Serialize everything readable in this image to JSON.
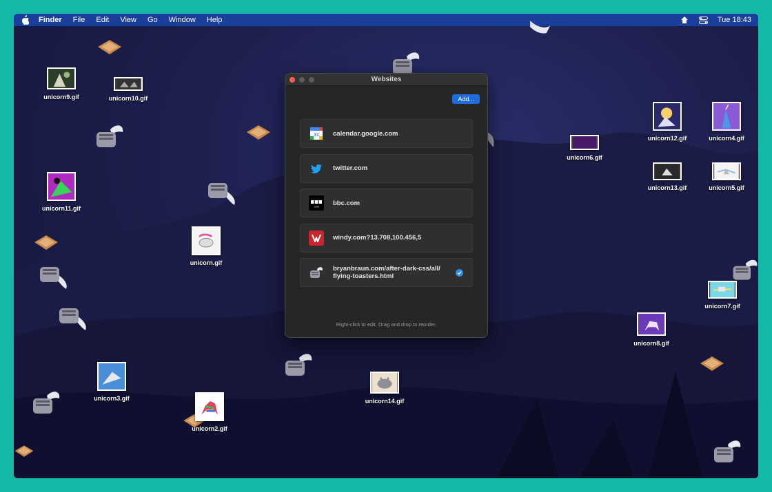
{
  "menubar": {
    "app": "Finder",
    "items": [
      "File",
      "Edit",
      "View",
      "Go",
      "Window",
      "Help"
    ],
    "clock": "Tue 18:43"
  },
  "desktop": {
    "icons": [
      {
        "name": "unicorn9.gif"
      },
      {
        "name": "unicorn10.gif"
      },
      {
        "name": "unicorn11.gif"
      },
      {
        "name": "unicorn.gif"
      },
      {
        "name": "unicorn3.gif"
      },
      {
        "name": "unicorn2.gif"
      },
      {
        "name": "unicorn14.gif"
      },
      {
        "name": "unicorn6.gif"
      },
      {
        "name": "unicorn12.gif"
      },
      {
        "name": "unicorn4.gif"
      },
      {
        "name": "unicorn13.gif"
      },
      {
        "name": "unicorn5.gif"
      },
      {
        "name": "unicorn7.gif"
      },
      {
        "name": "unicorn8.gif"
      }
    ]
  },
  "window": {
    "title": "Websites",
    "add_label": "Add...",
    "sites": [
      {
        "label": "calendar.google.com",
        "icon": "google-calendar-icon"
      },
      {
        "label": "twitter.com",
        "icon": "twitter-icon"
      },
      {
        "label": "bbc.com",
        "icon": "bbc-icon"
      },
      {
        "label": "windy.com?13.708,100.456,5",
        "icon": "windy-icon"
      },
      {
        "label": "bryanbraun.com/after-dark-css/all/\nflying-toasters.html",
        "icon": "flying-toaster-icon",
        "selected": true
      }
    ],
    "hint": "Right-click to edit. Drag and drop to reorder."
  },
  "colors": {
    "menubar": "#1a3f9a",
    "accent": "#1f6ddb",
    "frame": "#15b8a6"
  }
}
